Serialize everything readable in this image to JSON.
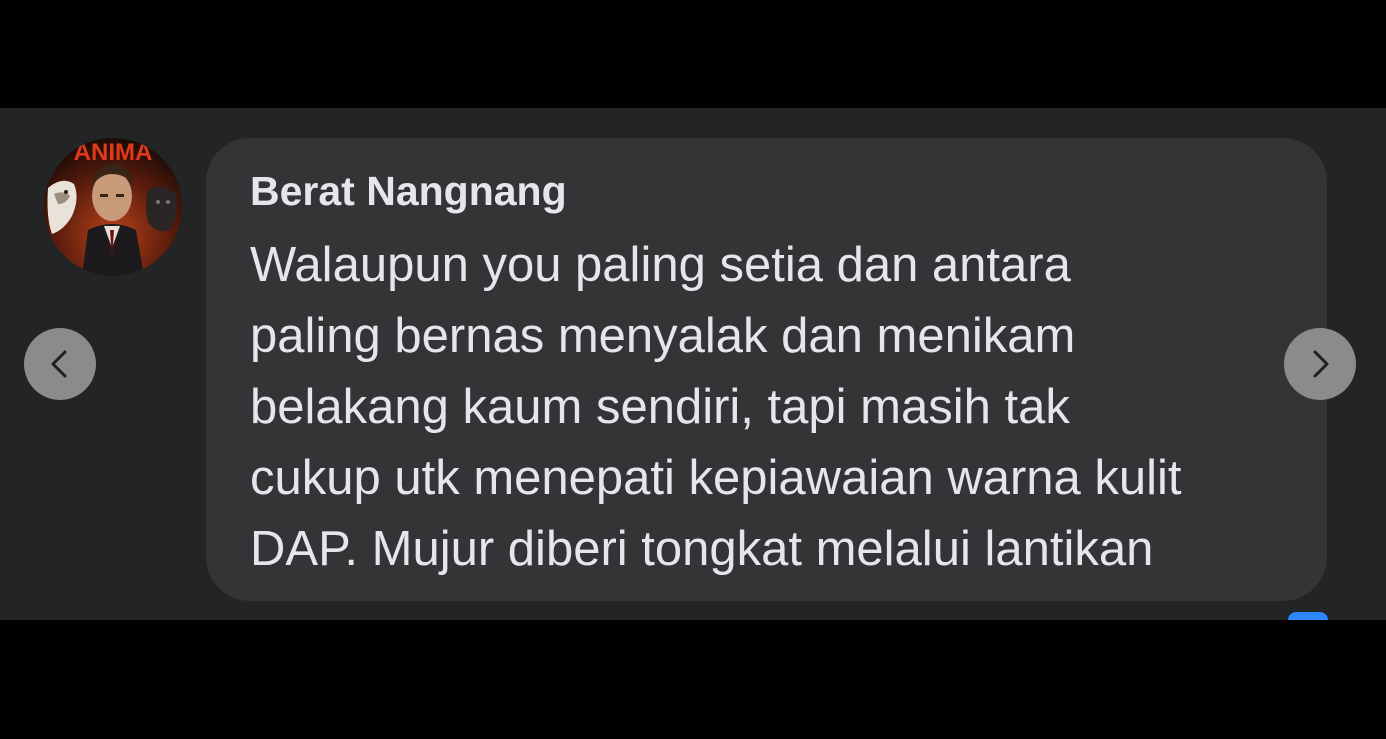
{
  "comment": {
    "author": "Berat Nangnang",
    "avatar_text": "ANIMA",
    "lines": [
      "Walaupun you paling setia dan antara",
      "paling bernas menyalak dan menikam",
      "belakang kaum sendiri, tapi masih tak",
      "cukup utk menepati kepiawaian warna kulit",
      "DAP. Mujur diberi tongkat melalui lantikan"
    ]
  },
  "navigation": {
    "prev_icon": "chevron-left-icon",
    "next_icon": "chevron-right-icon"
  },
  "colors": {
    "viewer_background": "#000000",
    "page_background": "#232425",
    "bubble_background": "#333436",
    "text": "#e4e6eb",
    "nav_button": "#8a8b8d",
    "accent": "#2d88ff"
  }
}
